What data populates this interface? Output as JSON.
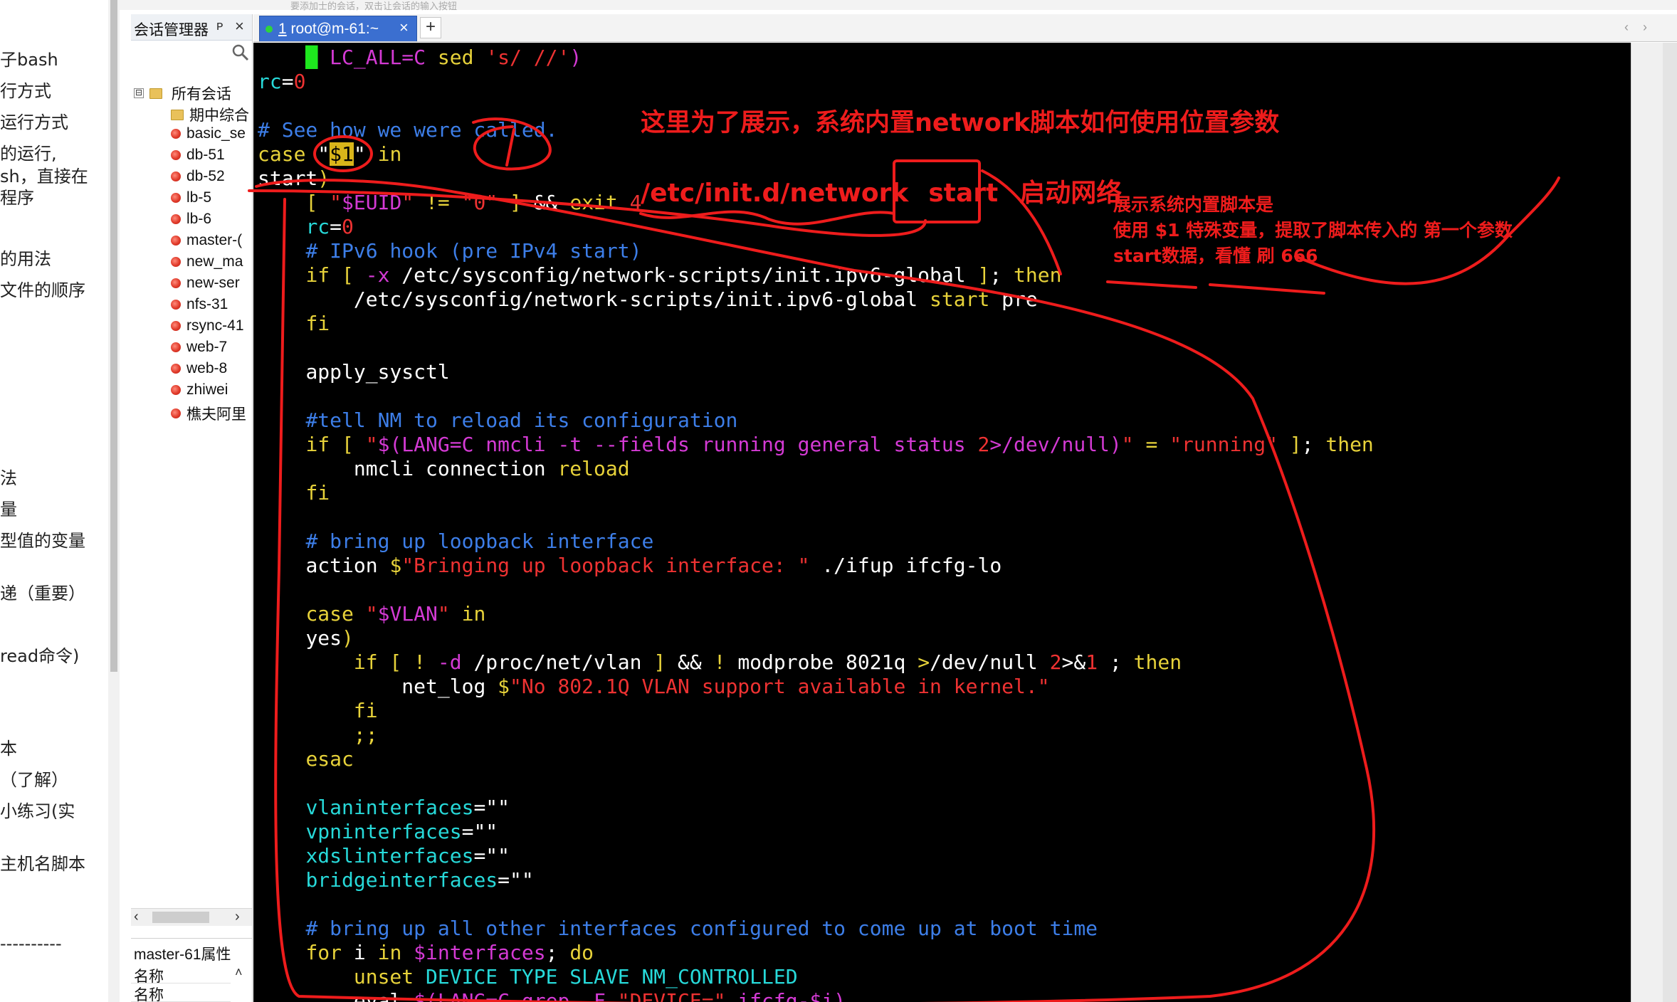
{
  "title_strip_text": "要添加士的会话，双击让会话的输入按钮",
  "notes": [
    "子bash",
    "行方式",
    "运行方式",
    "的运行,",
    "sh，直接在",
    "程序",
    "的用法",
    "文件的顺序",
    "法",
    "量",
    "型值的变量",
    "递（重要）",
    "read命令)",
    "本",
    "（了解）",
    "小练习(实",
    "主机名脚本",
    "----------"
  ],
  "session_manager": {
    "title": "会话管理器",
    "pin_label": "ᴘ",
    "close_label": "×",
    "root_toggle": "⊟",
    "root_label": "所有会话",
    "items": [
      {
        "label": "期中综合",
        "kind": "folder"
      },
      {
        "label": "basic_se",
        "kind": "session"
      },
      {
        "label": "db-51",
        "kind": "session"
      },
      {
        "label": "db-52",
        "kind": "session"
      },
      {
        "label": "lb-5",
        "kind": "session"
      },
      {
        "label": "lb-6",
        "kind": "session"
      },
      {
        "label": "master-(",
        "kind": "session"
      },
      {
        "label": "new_ma",
        "kind": "session"
      },
      {
        "label": "new-ser",
        "kind": "session"
      },
      {
        "label": "nfs-31",
        "kind": "session"
      },
      {
        "label": "rsync-41",
        "kind": "session"
      },
      {
        "label": "web-7",
        "kind": "session"
      },
      {
        "label": "web-8",
        "kind": "session"
      },
      {
        "label": "zhiwei",
        "kind": "session"
      },
      {
        "label": "樵夫阿里",
        "kind": "session"
      }
    ],
    "scroll_left": "‹",
    "scroll_right": "›",
    "props_title": "master-61属性",
    "props_rows": [
      "名称",
      "名称"
    ],
    "props_up": "˄"
  },
  "tabs": {
    "active_number": "1",
    "active_label": " root@m-61:~",
    "close": "×",
    "new": "+",
    "prev": "‹",
    "next": "›"
  },
  "terminal_lines": [
    {
      "indent": "    ",
      "segs": [
        {
          "t": "█",
          "c": "cursor-block"
        },
        {
          "t": " LC_ALL=C ",
          "c": "vr"
        },
        {
          "t": "sed ",
          "c": "kw"
        },
        {
          "t": "'s/ //'",
          "c": "st"
        },
        {
          "t": ")",
          "c": "vr"
        }
      ]
    },
    {
      "indent": "",
      "segs": [
        {
          "t": "rc",
          "c": "cy"
        },
        {
          "t": "=",
          "c": "w"
        },
        {
          "t": "0",
          "c": "nu"
        }
      ]
    },
    {
      "indent": "",
      "segs": []
    },
    {
      "indent": "",
      "segs": [
        {
          "t": "# See how we were called.",
          "c": "cm"
        }
      ]
    },
    {
      "indent": "",
      "segs": [
        {
          "t": "case",
          "c": "kw"
        },
        {
          "t": " \"",
          "c": "w"
        },
        {
          "t": "$1",
          "c": "hl"
        },
        {
          "t": "\" ",
          "c": "w"
        },
        {
          "t": "in",
          "c": "kw"
        }
      ]
    },
    {
      "indent": "",
      "segs": [
        {
          "t": "start",
          "c": "w"
        },
        {
          "t": ")",
          "c": "kw"
        }
      ]
    },
    {
      "indent": "    ",
      "segs": [
        {
          "t": "[ ",
          "c": "kw"
        },
        {
          "t": "\"",
          "c": "st"
        },
        {
          "t": "$EUID",
          "c": "vr"
        },
        {
          "t": "\" ",
          "c": "st"
        },
        {
          "t": "!= ",
          "c": "kw"
        },
        {
          "t": "\"0\"",
          "c": "st"
        },
        {
          "t": " ]",
          "c": "kw"
        },
        {
          "t": " && ",
          "c": "w"
        },
        {
          "t": "exit",
          "c": "kw"
        },
        {
          "t": " 4",
          "c": "nu"
        }
      ]
    },
    {
      "indent": "    ",
      "segs": [
        {
          "t": "rc",
          "c": "cy"
        },
        {
          "t": "=",
          "c": "w"
        },
        {
          "t": "0",
          "c": "nu"
        }
      ]
    },
    {
      "indent": "    ",
      "segs": [
        {
          "t": "# IPv6 hook (pre IPv4 start)",
          "c": "cm"
        }
      ]
    },
    {
      "indent": "    ",
      "segs": [
        {
          "t": "if",
          "c": "kw"
        },
        {
          "t": " [ ",
          "c": "kw"
        },
        {
          "t": "-x",
          "c": "vr"
        },
        {
          "t": " /etc/sysconfig/network-scripts/init.ipv6-global ",
          "c": "w"
        },
        {
          "t": "]",
          "c": "kw"
        },
        {
          "t": "; ",
          "c": "w"
        },
        {
          "t": "then",
          "c": "kw"
        }
      ]
    },
    {
      "indent": "        ",
      "segs": [
        {
          "t": "/etc/sysconfig/network-scripts/init.ipv6-global ",
          "c": "w"
        },
        {
          "t": "start",
          "c": "kw"
        },
        {
          "t": " pre",
          "c": "w"
        }
      ]
    },
    {
      "indent": "    ",
      "segs": [
        {
          "t": "fi",
          "c": "kw"
        }
      ]
    },
    {
      "indent": "",
      "segs": []
    },
    {
      "indent": "    ",
      "segs": [
        {
          "t": "apply_sysctl",
          "c": "w"
        }
      ]
    },
    {
      "indent": "",
      "segs": []
    },
    {
      "indent": "    ",
      "segs": [
        {
          "t": "#tell NM to reload its configuration",
          "c": "cm"
        }
      ]
    },
    {
      "indent": "    ",
      "segs": [
        {
          "t": "if",
          "c": "kw"
        },
        {
          "t": " [ ",
          "c": "kw"
        },
        {
          "t": "\"",
          "c": "st"
        },
        {
          "t": "$(LANG=C nmcli -t --fields running general status ",
          "c": "vr"
        },
        {
          "t": "2",
          "c": "nu"
        },
        {
          "t": ">/dev/null)",
          "c": "vr"
        },
        {
          "t": "\"",
          "c": "st"
        },
        {
          "t": " = ",
          "c": "kw"
        },
        {
          "t": "\"running\"",
          "c": "st"
        },
        {
          "t": " ]",
          "c": "kw"
        },
        {
          "t": "; ",
          "c": "w"
        },
        {
          "t": "then",
          "c": "kw"
        }
      ]
    },
    {
      "indent": "        ",
      "segs": [
        {
          "t": "nmcli connection ",
          "c": "w"
        },
        {
          "t": "reload",
          "c": "kw"
        }
      ]
    },
    {
      "indent": "    ",
      "segs": [
        {
          "t": "fi",
          "c": "kw"
        }
      ]
    },
    {
      "indent": "",
      "segs": []
    },
    {
      "indent": "    ",
      "segs": [
        {
          "t": "# bring up loopback interface",
          "c": "cm"
        }
      ]
    },
    {
      "indent": "    ",
      "segs": [
        {
          "t": "action ",
          "c": "w"
        },
        {
          "t": "$",
          "c": "bs"
        },
        {
          "t": "\"Bringing up loopback interface: \"",
          "c": "st"
        },
        {
          "t": " ./ifup ifcfg-lo",
          "c": "w"
        }
      ]
    },
    {
      "indent": "",
      "segs": []
    },
    {
      "indent": "    ",
      "segs": [
        {
          "t": "case",
          "c": "kw"
        },
        {
          "t": " \"",
          "c": "st"
        },
        {
          "t": "$VLAN",
          "c": "vr"
        },
        {
          "t": "\" ",
          "c": "st"
        },
        {
          "t": "in",
          "c": "kw"
        }
      ]
    },
    {
      "indent": "    ",
      "segs": [
        {
          "t": "yes",
          "c": "w"
        },
        {
          "t": ")",
          "c": "kw"
        }
      ]
    },
    {
      "indent": "        ",
      "segs": [
        {
          "t": "if",
          "c": "kw"
        },
        {
          "t": " [ ",
          "c": "kw"
        },
        {
          "t": "! ",
          "c": "kw"
        },
        {
          "t": "-d",
          "c": "vr"
        },
        {
          "t": " /proc/net/vlan ",
          "c": "w"
        },
        {
          "t": "]",
          "c": "kw"
        },
        {
          "t": " && ",
          "c": "w"
        },
        {
          "t": "! ",
          "c": "kw"
        },
        {
          "t": "modprobe 8021q ",
          "c": "w"
        },
        {
          "t": ">",
          "c": "kw"
        },
        {
          "t": "/dev/null ",
          "c": "w"
        },
        {
          "t": "2",
          "c": "nu"
        },
        {
          "t": ">&",
          "c": "w"
        },
        {
          "t": "1",
          "c": "nu"
        },
        {
          "t": " ; ",
          "c": "w"
        },
        {
          "t": "then",
          "c": "kw"
        }
      ]
    },
    {
      "indent": "            ",
      "segs": [
        {
          "t": "net_log ",
          "c": "w"
        },
        {
          "t": "$",
          "c": "bs"
        },
        {
          "t": "\"No 802.1Q VLAN support available in kernel.\"",
          "c": "st"
        }
      ]
    },
    {
      "indent": "        ",
      "segs": [
        {
          "t": "fi",
          "c": "kw"
        }
      ]
    },
    {
      "indent": "        ",
      "segs": [
        {
          "t": ";;",
          "c": "kw"
        }
      ]
    },
    {
      "indent": "    ",
      "segs": [
        {
          "t": "esac",
          "c": "kw"
        }
      ]
    },
    {
      "indent": "",
      "segs": []
    },
    {
      "indent": "    ",
      "segs": [
        {
          "t": "vlaninterfaces",
          "c": "cy"
        },
        {
          "t": "=\"\"",
          "c": "w"
        }
      ]
    },
    {
      "indent": "    ",
      "segs": [
        {
          "t": "vpninterfaces",
          "c": "cy"
        },
        {
          "t": "=\"\"",
          "c": "w"
        }
      ]
    },
    {
      "indent": "    ",
      "segs": [
        {
          "t": "xdslinterfaces",
          "c": "cy"
        },
        {
          "t": "=\"\"",
          "c": "w"
        }
      ]
    },
    {
      "indent": "    ",
      "segs": [
        {
          "t": "bridgeinterfaces",
          "c": "cy"
        },
        {
          "t": "=\"\"",
          "c": "w"
        }
      ]
    },
    {
      "indent": "",
      "segs": []
    },
    {
      "indent": "    ",
      "segs": [
        {
          "t": "# bring up all other interfaces configured to come up at boot time",
          "c": "cm"
        }
      ]
    },
    {
      "indent": "    ",
      "segs": [
        {
          "t": "for",
          "c": "kw"
        },
        {
          "t": " i ",
          "c": "w"
        },
        {
          "t": "in",
          "c": "kw"
        },
        {
          "t": " ",
          "c": "w"
        },
        {
          "t": "$interfaces",
          "c": "vr"
        },
        {
          "t": "; ",
          "c": "w"
        },
        {
          "t": "do",
          "c": "kw"
        }
      ]
    },
    {
      "indent": "        ",
      "segs": [
        {
          "t": "unset",
          "c": "kw"
        },
        {
          "t": " DEVICE TYPE SLAVE NM_CONTROLLED",
          "c": "cy"
        }
      ]
    },
    {
      "indent": "        ",
      "segs": [
        {
          "t": "eval ",
          "c": "w"
        },
        {
          "t": "$(LANG=C grep -F ",
          "c": "vr"
        },
        {
          "t": "\"DEVICE=\"",
          "c": "st"
        },
        {
          "t": " ifcfg-$i)",
          "c": "vr"
        }
      ]
    }
  ],
  "annotation": {
    "heading": "这里为了展示，系统内置network脚本如何使用位置参数",
    "command": "/etc/init.d/network",
    "command_arg": "start",
    "command_note": "启动网络",
    "note_lines": [
      "展示系统内置脚本是",
      "使用 $1 特殊变量，提取了脚本传入的 第一个参数",
      "start数据，看懂 刷 666"
    ],
    "color": "#ee1c1c"
  }
}
